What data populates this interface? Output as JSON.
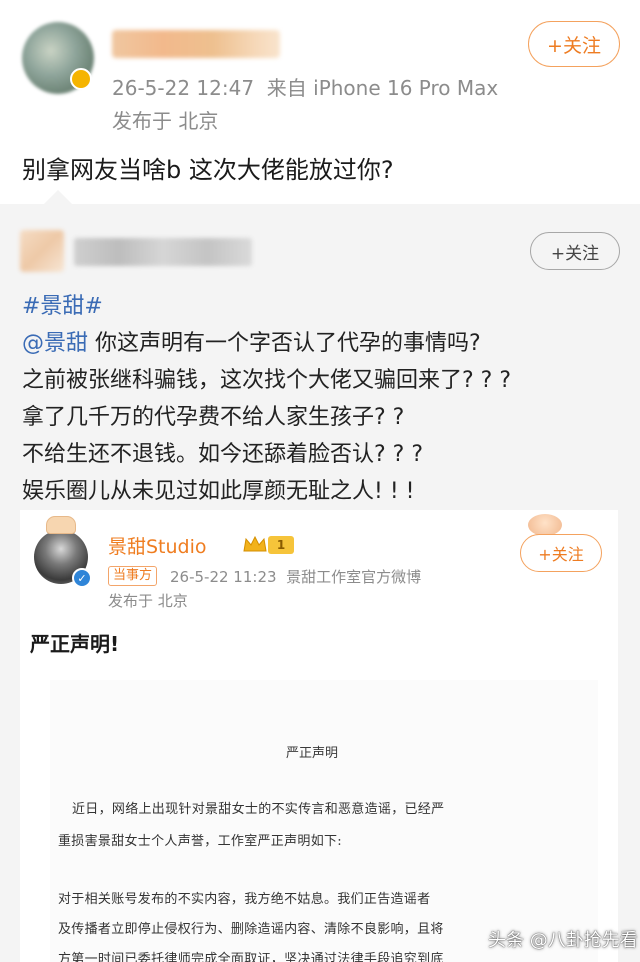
{
  "post": {
    "timestamp": "26-5-22 12:47",
    "source": "来自 iPhone 16 Pro Max",
    "location": "发布于 北京",
    "follow_label": "+关注",
    "text": "别拿网友当啥b 这次大佬能放过你?"
  },
  "repost": {
    "follow_label": "+关注",
    "hashtag": "#景甜#",
    "mention": "@景甜",
    "line1_rest": " 你这声明有一个字否认了代孕的事情吗?",
    "line2": "之前被张继科骗钱，这次找个大佬又骗回来了? ? ?",
    "line3": "拿了几千万的代孕费不给人家生孩子? ?",
    "line4": "不给生还不退钱。如今还舔着脸否认? ? ?",
    "line5": "娱乐圈儿从未见过如此厚颜无耻之人! ! !"
  },
  "quoted": {
    "name": "景甜Studio",
    "level": "1",
    "tag": "当事方",
    "timestamp": "26-5-22 11:23",
    "source": "景甜工作室官方微博",
    "location": "发布于 北京",
    "follow_label": "+关注",
    "text": "严正声明!",
    "document": {
      "title": "严正声明",
      "p1_line1": "近日，网络上出现针对景甜女士的不实传言和恶意造谣，已经严",
      "p1_line2": "重损害景甜女士个人声誉，工作室严正声明如下:",
      "p2_line1": "对于相关账号发布的不实内容，我方绝不姑息。我们正告造谣者",
      "p2_line2": "及传播者立即停止侵权行为、删除造谣内容、清除不良影响，且将",
      "p2_line3": "方第一时间已委托律师完成全面取证，坚决通过法律手段追究到底"
    }
  },
  "watermark": "头条 @八卦抢先看",
  "colors": {
    "accent_orange": "#ee7c22",
    "link_blue": "#3a6bb5",
    "quote_bg": "#f4f4f4"
  }
}
